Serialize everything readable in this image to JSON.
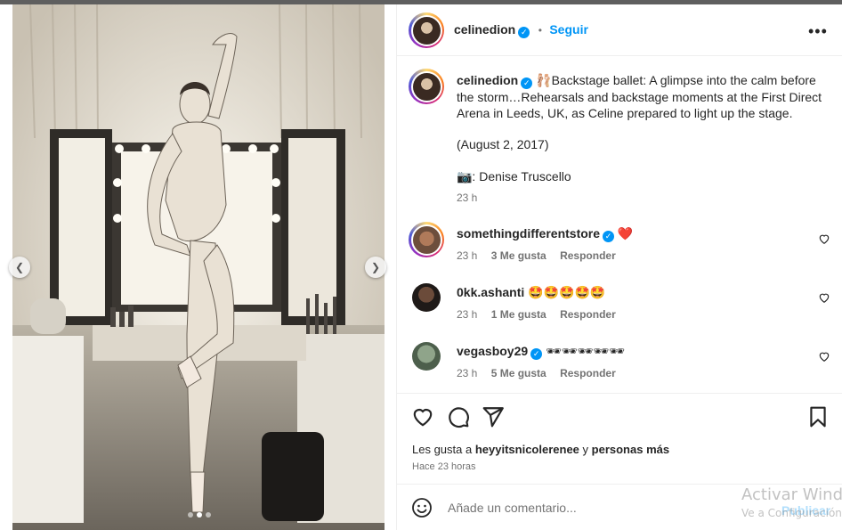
{
  "post": {
    "author": "celinedion",
    "follow_label": "Seguir",
    "separator": "•",
    "more_label": "•••",
    "caption": {
      "author": "celinedion",
      "emoji": "🩰",
      "line1": "Backstage ballet: A glimpse into the calm before the storm…Rehearsals and backstage moments at the First Direct Arena in Leeds, UK, as Celine prepared to light up the stage.",
      "line2": "(August 2, 2017)",
      "line3": "📷: Denise Truscello",
      "time": "23 h"
    },
    "comments": [
      {
        "user": "somethingdifferentstore",
        "verified": true,
        "text": "❤️",
        "time": "23 h",
        "likes": "3 Me gusta",
        "reply": "Responder"
      },
      {
        "user": "0kk.ashanti",
        "verified": false,
        "text": "🤩🤩🤩🤩🤩",
        "time": "23 h",
        "likes": "1 Me gusta",
        "reply": "Responder"
      },
      {
        "user": "vegasboy29",
        "verified": true,
        "text": "🕶🕶🕶🕶🕶",
        "time": "23 h",
        "likes": "5 Me gusta",
        "reply": "Responder"
      }
    ],
    "likes": {
      "prefix": "Les gusta a",
      "user": "heyyitsnicolerenee",
      "connector": "y",
      "rest": "personas más"
    },
    "posted_ago": "Hace 23 horas",
    "comment_placeholder": "Añade un comentario...",
    "publish_label": "Publicar",
    "carousel": {
      "total": 3,
      "active": 2
    }
  },
  "icons": {
    "prev": "chevron-left-icon",
    "next": "chevron-right-icon",
    "like": "heart-icon",
    "comment": "comment-bubble-icon",
    "share": "paper-plane-icon",
    "save": "bookmark-icon",
    "emoji": "smiley-icon"
  },
  "watermark": {
    "line1": "Activar Windows",
    "line2": "Ve a Configuración para activar Windows."
  },
  "colors": {
    "accent": "#0095f6",
    "publish_disabled": "#b2dffc",
    "heart_red": "#ed4956"
  }
}
